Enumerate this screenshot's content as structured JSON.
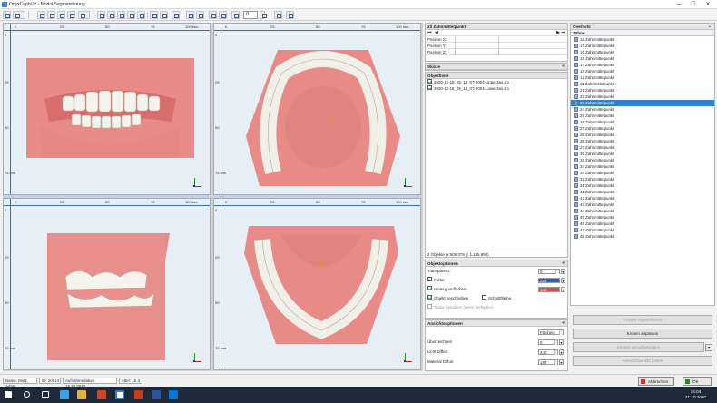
{
  "window": {
    "title": "OnyxCeph³™ - Modul Segmentierung",
    "minimize": "—",
    "maximize": "☐",
    "close": "✕"
  },
  "toolbar": {
    "zoom_value": "0"
  },
  "viewports": {
    "ruler_top_ticks": [
      "0",
      "25",
      "50",
      "75",
      "100 mm"
    ],
    "ruler_left_ticks": [
      "0",
      "25",
      "50",
      "75 mm"
    ]
  },
  "tooth_point": {
    "title": "23 Zahnmittelpunkt",
    "pos_x": "Position X:",
    "pos_y": "Position Y:",
    "pos_z": "Position Z:"
  },
  "skizze": {
    "title": "Skizze"
  },
  "object_list": {
    "title": "Objektliste",
    "items": [
      "2020-10-18_09_18_07-2004-Upper3av.1.1",
      "2020-10-18_09_18_07-2004-Lower3av.1.1"
    ],
    "footer": "2 Objekte (x:500.375 y: 1.135.894)"
  },
  "object_options": {
    "title": "Objektoptionen",
    "transparency_label": "Transparenz:",
    "transparency_value": "0",
    "color_label": "Farbe:",
    "color_value": "224",
    "bg_color_label": "Hintergrundfarben:",
    "bg_color_value": "144",
    "obj_describe": "Objekt beschreiben",
    "cut_surface": "Schnittfläche",
    "texture": "Textur benutzen (wenn verfügbar)",
    "color_swatch_1": "#3c5ea8",
    "color_swatch_2": "#d94a4a"
  },
  "view_options": {
    "title": "Ansichtsoptionen",
    "mode_value": "Flächen",
    "overlay_label": "Überzeichnen",
    "overlay_value": "0",
    "light_label": "Licht Diffus:",
    "light_value": "240",
    "material_label": "Material Diffus:",
    "material_value": "192"
  },
  "overview": {
    "title": "Overlists",
    "header": "Zähne",
    "teeth": [
      "18 Zahnmittelpunkt",
      "17 Zahnmittelpunkt",
      "16 Zahnmittelpunkt",
      "15 Zahnmittelpunkt",
      "14 Zahnmittelpunkt",
      "13 Zahnmittelpunkt",
      "12 Zahnmittelpunkt",
      "11 Zahnmittelpunkt",
      "21 Zahnmittelpunkt",
      "22 Zahnmittelpunkt",
      "23 Zahnmittelpunkt",
      "24 Zahnmittelpunkt",
      "25 Zahnmittelpunkt",
      "26 Zahnmittelpunkt",
      "27 Zahnmittelpunkt",
      "28 Zahnmittelpunkt",
      "38 Zahnmittelpunkt",
      "37 Zahnmittelpunkt",
      "36 Zahnmittelpunkt",
      "35 Zahnmittelpunkt",
      "34 Zahnmittelpunkt",
      "33 Zahnmittelpunkt",
      "32 Zahnmittelpunkt",
      "31 Zahnmittelpunkt",
      "41 Zahnmittelpunkt",
      "42 Zahnmittelpunkt",
      "43 Zahnmittelpunkt",
      "44 Zahnmittelpunkt",
      "45 Zahnmittelpunkt",
      "46 Zahnmittelpunkt",
      "47 Zahnmittelpunkt",
      "48 Zahnmittelpunkt"
    ],
    "selected_index": 10
  },
  "actions": {
    "segment": "Kronen segmentieren",
    "crown_adjust": "Kronen anpassen",
    "crown_ops": "Kronen vervollständigen",
    "reference": "Referenzpunkte prüfen"
  },
  "status": {
    "name": "Name: Mutz, Adam",
    "id": "ID: 20014",
    "date": "Aufnahmedatum: 16.10.2020",
    "age": "Alter: 15,3"
  },
  "footer_buttons": {
    "cancel": "Abbrechen",
    "ok": "OK"
  },
  "taskbar": {
    "time": "14:04",
    "date": "21.10.2020"
  }
}
